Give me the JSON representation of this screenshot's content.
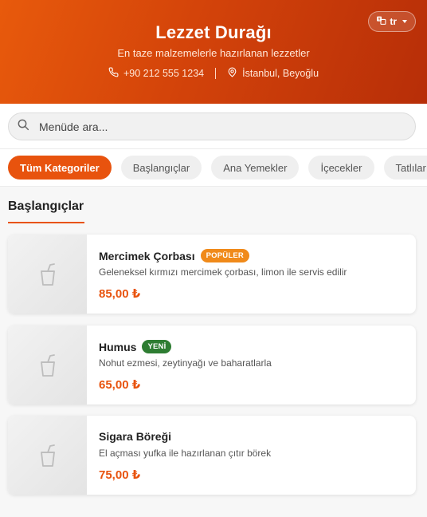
{
  "header": {
    "title": "Lezzet Durağı",
    "tagline": "En taze malzemelerle hazırlanan lezzetler",
    "phone": "+90 212 555 1234",
    "location": "İstanbul, Beyoğlu",
    "language": "tr"
  },
  "search": {
    "placeholder": "Menüde ara..."
  },
  "categories": [
    "Tüm Kategoriler",
    "Başlangıçlar",
    "Ana Yemekler",
    "İçecekler",
    "Tatlılar"
  ],
  "section": {
    "title": "Başlangıçlar"
  },
  "items": [
    {
      "name": "Mercimek Çorbası",
      "badge": "POPÜLER",
      "description": "Geleneksel kırmızı mercimek çorbası, limon ile servis edilir",
      "price": "85,00 ₺"
    },
    {
      "name": "Humus",
      "badge": "YENİ",
      "description": "Nohut ezmesi, zeytinyağı ve baharatlarla",
      "price": "65,00 ₺"
    },
    {
      "name": "Sigara Böreği",
      "badge": "",
      "description": "El açması yufka ile hazırlanan çıtır börek",
      "price": "75,00 ₺"
    }
  ],
  "colors": {
    "accent": "#e8530e",
    "popular_badge": "#f08a1a",
    "new_badge": "#2e7d32"
  }
}
